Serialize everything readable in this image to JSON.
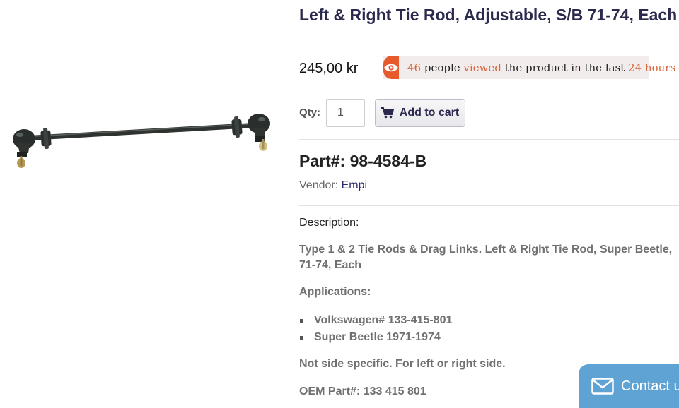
{
  "product": {
    "title": "Left & Right Tie Rod, Adjustable, S/B 71-74, Each",
    "price": "245,00 kr",
    "image_icon": "tie-rod-image"
  },
  "viewers": {
    "count": "46",
    "text1": " people ",
    "viewed": "viewed",
    "text2": " the product in the last ",
    "hours": "24 hours",
    "accent_color": "#e65a2c"
  },
  "cart": {
    "qty_label": "Qty:",
    "qty_value": "1",
    "add_label": "Add to cart"
  },
  "part": {
    "label": "Part#: 98-4584-B",
    "vendor_label": "Vendor: ",
    "vendor_name": "Empi"
  },
  "description": {
    "label": "Description:",
    "body": "Type 1 & 2 Tie Rods & Drag Links. Left & Right Tie Rod, Super Beetle, 71-74, Each",
    "applications_label": "Applications:",
    "applications": [
      "Volkswagen# 133-415-801",
      "Super Beetle 1971-1974"
    ],
    "side_note": "Not side specific. For left or right side.",
    "oem": "OEM Part#: 133 415 801"
  },
  "contact": {
    "label": "Contact us",
    "color": "#5fa3d4"
  }
}
